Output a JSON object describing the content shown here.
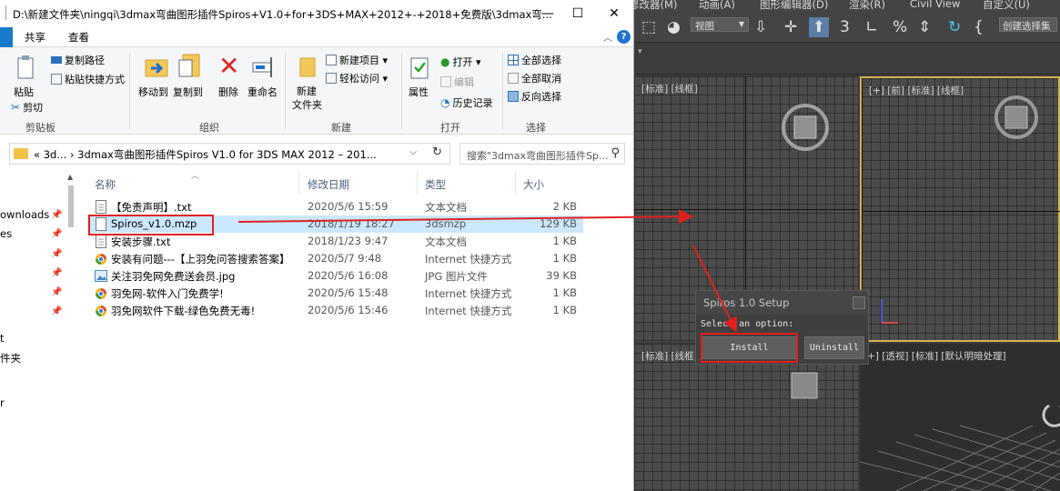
{
  "explorer": {
    "title_path": "D:\\新建文件夹\\ningqi\\3dmax弯曲图形插件Spiros+V1.0+for+3DS+MAX+2012+-+2018+免费版\\3dmax弯...",
    "window_buttons": {
      "minimize": "—",
      "maximize": "☐",
      "close": "✕"
    },
    "tabs": [
      "共享",
      "查看"
    ],
    "ribbon": {
      "clipboard": {
        "label": "剪贴板",
        "paste": "粘贴",
        "copy_path": "复制路径",
        "paste_shortcut": "粘贴快捷方式",
        "cut": "剪切"
      },
      "organize": {
        "label": "组织",
        "move_to": "移动到",
        "copy_to": "复制到",
        "delete": "删除",
        "rename": "重命名"
      },
      "new": {
        "label": "新建",
        "new_folder_line1": "新建",
        "new_folder_line2": "文件夹",
        "new_item": "新建项目 ▾",
        "easy_access": "轻松访问 ▾"
      },
      "open": {
        "label": "打开",
        "properties": "属性",
        "open": "打开 ▾",
        "edit": "编辑",
        "history": "历史记录"
      },
      "select": {
        "label": "选择",
        "select_all": "全部选择",
        "select_none": "全部取消",
        "invert": "反向选择"
      }
    },
    "address": {
      "text": "«  3d...  ›  3dmax弯曲图形插件Spiros V1.0 for 3DS MAX 2012 – 201...",
      "search_placeholder": "搜索\"3dmax弯曲图形插件Sp..."
    },
    "nav_items": [
      "ownloads",
      "es",
      "t",
      "件夹",
      "r"
    ],
    "columns": {
      "name": "名称",
      "date": "修改日期",
      "type": "类型",
      "size": "大小"
    },
    "files": [
      {
        "name": "【免责声明】.txt",
        "date": "2020/5/6 15:59",
        "type": "文本文档",
        "size": "2 KB",
        "icon": "txt"
      },
      {
        "name": "Spiros_v1.0.mzp",
        "date": "2018/1/19 18:27",
        "type": "3dsmzp",
        "size": "129 KB",
        "icon": "file"
      },
      {
        "name": "安装步骤.txt",
        "date": "2018/1/23 9:47",
        "type": "文本文档",
        "size": "1 KB",
        "icon": "txt"
      },
      {
        "name": "安装有问题---【上羽免问答搜索答案】",
        "date": "2020/5/7 9:48",
        "type": "Internet 快捷方式",
        "size": "1 KB",
        "icon": "web"
      },
      {
        "name": "关注羽免网免费送会员.jpg",
        "date": "2020/5/6 16:08",
        "type": "JPG 图片文件",
        "size": "39 KB",
        "icon": "img"
      },
      {
        "name": "羽免网-软件入门免费学!",
        "date": "2020/5/6 15:48",
        "type": "Internet 快捷方式",
        "size": "1 KB",
        "icon": "web"
      },
      {
        "name": "羽免网软件下载-绿色免费无毒!",
        "date": "2020/5/6 15:46",
        "type": "Internet 快捷方式",
        "size": "1 KB",
        "icon": "web"
      }
    ]
  },
  "max": {
    "menu": [
      "修改器(M)",
      "动画(A)",
      "图形编辑器(D)",
      "渲染(R)",
      "Civil View",
      "自定义(U)"
    ],
    "view_dropdown": "视图",
    "selection_set": "创建选择集",
    "viewports": {
      "top_left": "[标准] [线框]",
      "front": "[+] [前] [标准] [线框]",
      "left": "[标准] [线框]",
      "perspective": "[+] [透视] [标准] [默认明暗处理]"
    },
    "dialog": {
      "title": "Spiros 1.0 Setup",
      "prompt": "Select an option:",
      "install": "Install",
      "uninstall": "Uninstall"
    }
  },
  "colors": {
    "selection": "#cce8ff",
    "annotation": "#e02020",
    "viewport_active": "#d5b44a"
  }
}
